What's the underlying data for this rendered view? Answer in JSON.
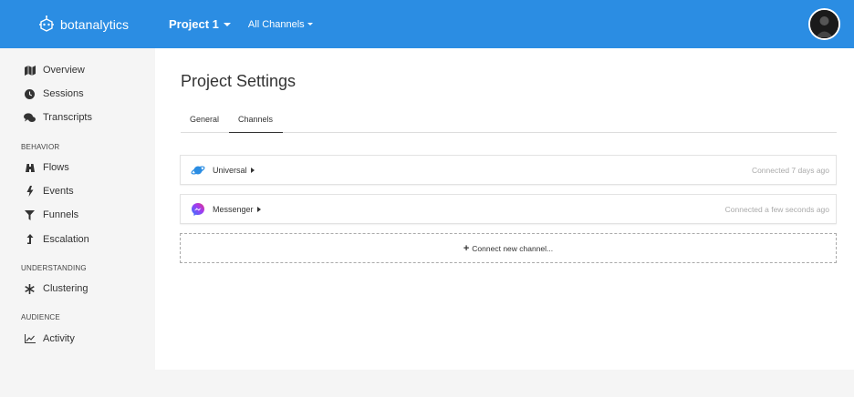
{
  "header": {
    "brand": "botanalytics",
    "project": "Project 1",
    "channels": "All Channels"
  },
  "sidebar": {
    "items": [
      {
        "label": "Overview",
        "icon": "map-icon"
      },
      {
        "label": "Sessions",
        "icon": "clock-icon"
      },
      {
        "label": "Transcripts",
        "icon": "chat-icon"
      }
    ],
    "sections": [
      {
        "label": "BEHAVIOR",
        "items": [
          {
            "label": "Flows",
            "icon": "binoculars-icon"
          },
          {
            "label": "Events",
            "icon": "bolt-icon"
          },
          {
            "label": "Funnels",
            "icon": "filter-icon"
          },
          {
            "label": "Escalation",
            "icon": "arrow-up-icon"
          }
        ]
      },
      {
        "label": "UNDERSTANDING",
        "items": [
          {
            "label": "Clustering",
            "icon": "asterisk-icon"
          }
        ]
      },
      {
        "label": "AUDIENCE",
        "items": [
          {
            "label": "Activity",
            "icon": "line-chart-icon"
          }
        ]
      }
    ]
  },
  "main": {
    "title": "Project Settings",
    "tabs": [
      {
        "label": "General",
        "active": false
      },
      {
        "label": "Channels",
        "active": true
      }
    ],
    "channels": [
      {
        "name": "Universal",
        "status": "Connected 7 days ago",
        "icon": "planet-icon"
      },
      {
        "name": "Messenger",
        "status": "Connected a few seconds ago",
        "icon": "messenger-icon"
      }
    ],
    "connect_label": "Connect new channel..."
  },
  "colors": {
    "header": "#2b8de3",
    "sidebar_bg": "#f5f5f5",
    "messenger_start": "#2f7bff",
    "messenger_end": "#e5337c"
  }
}
